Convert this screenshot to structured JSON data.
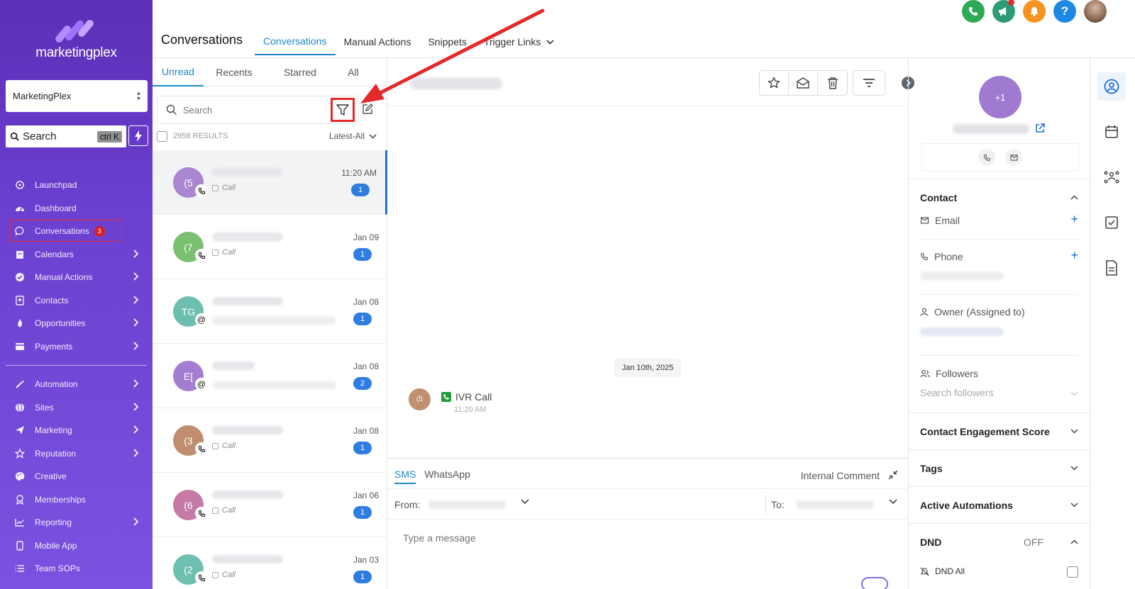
{
  "sidebar": {
    "brand": "marketingplex",
    "account": "MarketingPlex",
    "search_label": "Search",
    "search_shortcut": "ctrl K",
    "items": [
      {
        "label": "Launchpad",
        "chevron": false
      },
      {
        "label": "Dashboard",
        "chevron": false
      },
      {
        "label": "Conversations",
        "chevron": false,
        "badge": "3",
        "active": true
      },
      {
        "label": "Calendars",
        "chevron": true
      },
      {
        "label": "Manual Actions",
        "chevron": true
      },
      {
        "label": "Contacts",
        "chevron": true
      },
      {
        "label": "Opportunities",
        "chevron": true
      },
      {
        "label": "Payments",
        "chevron": true
      }
    ],
    "items2": [
      {
        "label": "Automation",
        "chevron": true
      },
      {
        "label": "Sites",
        "chevron": true
      },
      {
        "label": "Marketing",
        "chevron": true
      },
      {
        "label": "Reputation",
        "chevron": true
      },
      {
        "label": "Creative",
        "chevron": false
      },
      {
        "label": "Memberships",
        "chevron": false
      },
      {
        "label": "Reporting",
        "chevron": true
      },
      {
        "label": "Mobile App",
        "chevron": false
      },
      {
        "label": "Team SOPs",
        "chevron": false
      }
    ]
  },
  "header": {
    "title": "Conversations",
    "tabs": [
      "Conversations",
      "Manual Actions",
      "Snippets",
      "Trigger Links"
    ],
    "active_tab": 0,
    "icon_colors": {
      "phone": "#2eaa56",
      "announce": "#2c9b76",
      "bell": "#f7931e",
      "help": "#1e88e5"
    }
  },
  "list": {
    "tabs": [
      "Unread",
      "Recents",
      "Starred",
      "All"
    ],
    "search_placeholder": "Search",
    "results": "2958 RESULTS",
    "sort": "Latest-All",
    "conversations": [
      {
        "initials": "(5",
        "color": "#a986cf",
        "channel": "phone",
        "sub": "Call",
        "time": "11:20 AM",
        "count": "1",
        "selected": true
      },
      {
        "initials": "(7",
        "color": "#79c070",
        "channel": "phone",
        "sub": "Call",
        "time": "Jan 09",
        "count": "1"
      },
      {
        "initials": "TG",
        "color": "#6cbfae",
        "channel": "email",
        "sub": "",
        "time": "Jan 08",
        "count": "1"
      },
      {
        "initials": "E[",
        "color": "#a47dd1",
        "channel": "email",
        "sub": "",
        "time": "Jan 08",
        "count": "2"
      },
      {
        "initials": "(3",
        "color": "#c08d6e",
        "channel": "phone",
        "sub": "Call",
        "time": "Jan 08",
        "count": "1"
      },
      {
        "initials": "(6",
        "color": "#c67aa6",
        "channel": "phone",
        "sub": "Call",
        "time": "Jan 06",
        "count": "1"
      },
      {
        "initials": "(2",
        "color": "#6fbfb0",
        "channel": "phone",
        "sub": "Call",
        "time": "Jan 03",
        "count": "1"
      }
    ]
  },
  "thread": {
    "date_chip": "Jan 10th, 2025",
    "message_initials": "(5",
    "message_title": "IVR Call",
    "message_time": "11:20 AM"
  },
  "composer": {
    "tabs": [
      "SMS",
      "WhatsApp"
    ],
    "internal": "Internal Comment",
    "from_label": "From:",
    "to_label": "To:",
    "placeholder": "Type a message"
  },
  "contact": {
    "avatar": "+1",
    "contact_title": "Contact",
    "email_label": "Email",
    "phone_label": "Phone",
    "owner_label": "Owner (Assigned to)",
    "followers_label": "Followers",
    "followers_placeholder": "Search followers",
    "engagement": "Contact Engagement Score",
    "tags": "Tags",
    "automations": "Active Automations",
    "dnd": "DND",
    "dnd_state": "OFF",
    "dnd_all": "DND All"
  },
  "accent": "#1e88c7"
}
